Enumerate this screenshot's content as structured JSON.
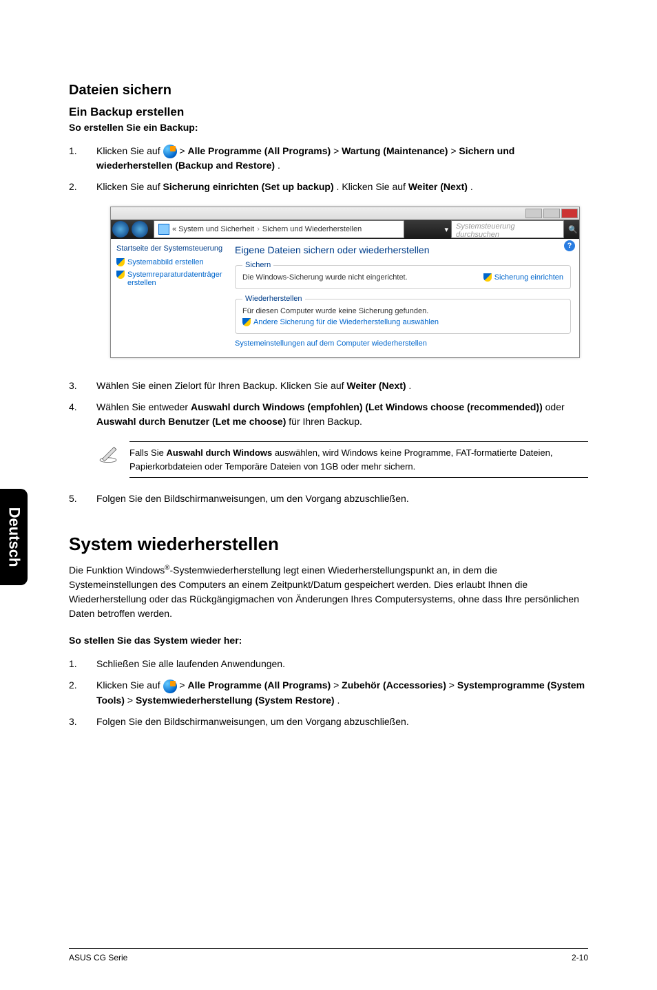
{
  "sidetab": "Deutsch",
  "h_dateien": "Dateien sichern",
  "h_backup": "Ein Backup erstellen",
  "instr_backup": "So erstellen Sie ein Backup:",
  "steps1": {
    "n1": "1.",
    "s1a": "Klicken Sie auf ",
    "s1b": " > ",
    "s1c": "Alle Programme (All Programs)",
    "s1d": " > ",
    "s1e": "Wartung (Maintenance)",
    "s1f": " > ",
    "s1g": "Sichern und wiederherstellen (Backup and Restore)",
    "s1h": ".",
    "n2": "2.",
    "s2a": "Klicken Sie auf ",
    "s2b": "Sicherung einrichten (Set up backup)",
    "s2c": ". Klicken Sie auf ",
    "s2d": "Weiter (Next)",
    "s2e": "."
  },
  "screenshot": {
    "crumb_a": "System und Sicherheit",
    "crumb_b": "Sichern und Wiederherstellen",
    "search_placeholder": "Systemsteuerung durchsuchen",
    "side_heading": "Startseite der Systemsteuerung",
    "side_link1": "Systemabbild erstellen",
    "side_link2": "Systemreparaturdatenträger erstellen",
    "main_title": "Eigene Dateien sichern oder wiederherstellen",
    "legend1": "Sichern",
    "msg1": "Die Windows-Sicherung wurde nicht eingerichtet.",
    "link1": "Sicherung einrichten",
    "legend2": "Wiederherstellen",
    "msg2": "Für diesen Computer wurde keine Sicherung gefunden.",
    "link2": "Andere Sicherung für die Wiederherstellung auswählen",
    "link3": "Systemeinstellungen auf dem Computer wiederherstellen",
    "help": "?"
  },
  "steps2": {
    "n3": "3.",
    "s3a": "Wählen Sie einen Zielort für Ihren Backup. Klicken Sie auf ",
    "s3b": "Weiter (Next)",
    "s3c": ".",
    "n4": "4.",
    "s4a": "Wählen Sie entweder ",
    "s4b": "Auswahl durch Windows (empfohlen) (Let Windows choose (recommended))",
    "s4c": " oder ",
    "s4d": "Auswahl durch Benutzer (Let me choose)",
    "s4e": " für Ihren Backup."
  },
  "note": {
    "a": "Falls Sie ",
    "b": "Auswahl durch Windows",
    "c": " auswählen, wird Windows keine Programme, FAT-formatierte Dateien, Papierkorbdateien oder Temporäre Dateien von 1GB oder mehr sichern."
  },
  "steps3": {
    "n5": "5.",
    "s5": "Folgen Sie den Bildschirmanweisungen, um den Vorgang abzuschließen."
  },
  "h_system": "System wiederherstellen",
  "para_sys_a": "Die Funktion Windows",
  "para_sys_sup": "®",
  "para_sys_b": "-Systemwiederherstellung legt einen Wiederherstellungspunkt an, in dem die Systemeinstellungen des Computers an einem Zeitpunkt/Datum gespeichert werden. Dies erlaubt Ihnen die Wiederherstellung oder das Rückgängigmachen von Änderungen Ihres Computersystems, ohne dass Ihre persönlichen Daten betroffen werden.",
  "instr_sys": "So stellen Sie das System wieder her:",
  "steps4": {
    "n1": "1.",
    "s1": "Schließen Sie alle laufenden Anwendungen.",
    "n2": "2.",
    "s2a": "Klicken Sie auf ",
    "s2b": " > ",
    "s2c": "Alle Programme (All Programs)",
    "s2d": " > ",
    "s2e": "Zubehör (Accessories)",
    "s2f": " > ",
    "s2g": "Systemprogramme (System Tools)",
    "s2h": " > ",
    "s2i": "Systemwiederherstellung (System Restore)",
    "s2j": ".",
    "n3": "3.",
    "s3": "Folgen Sie den Bildschirmanweisungen, um den Vorgang abzuschließen."
  },
  "footer_left": "ASUS CG Serie",
  "footer_right": "2-10"
}
